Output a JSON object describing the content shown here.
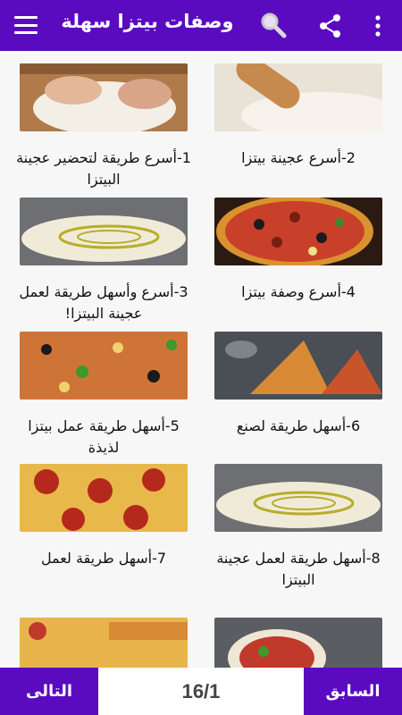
{
  "header": {
    "title": "وصفات بيتزا سهلة",
    "icons": [
      "menu-icon",
      "search-icon",
      "share-icon",
      "more-vert-icon"
    ]
  },
  "recipes": [
    {
      "label": "1-أسرع طريقة لتحضير عجينة البيتزا"
    },
    {
      "label": "2-أسرع عجينة بيتزا"
    },
    {
      "label": "3-أسرع وأسهل طريقة لعمل عجينة البيتزا!"
    },
    {
      "label": "4-أسرع وصفة بيتزا"
    },
    {
      "label": "5-أسهل طريقة عمل بيتزا لذيذة"
    },
    {
      "label": "6-أسهل طريقة لصنع"
    },
    {
      "label": "7-أسهل طريقة لعمل"
    },
    {
      "label": "8-أسهل طريقة لعمل عجينة البيتزا"
    }
  ],
  "pagination": {
    "next_label": "التالى",
    "prev_label": "السابق",
    "page_text": "16/1"
  },
  "colors": {
    "primary": "#5a0bc0",
    "background": "#f7f7f7"
  }
}
